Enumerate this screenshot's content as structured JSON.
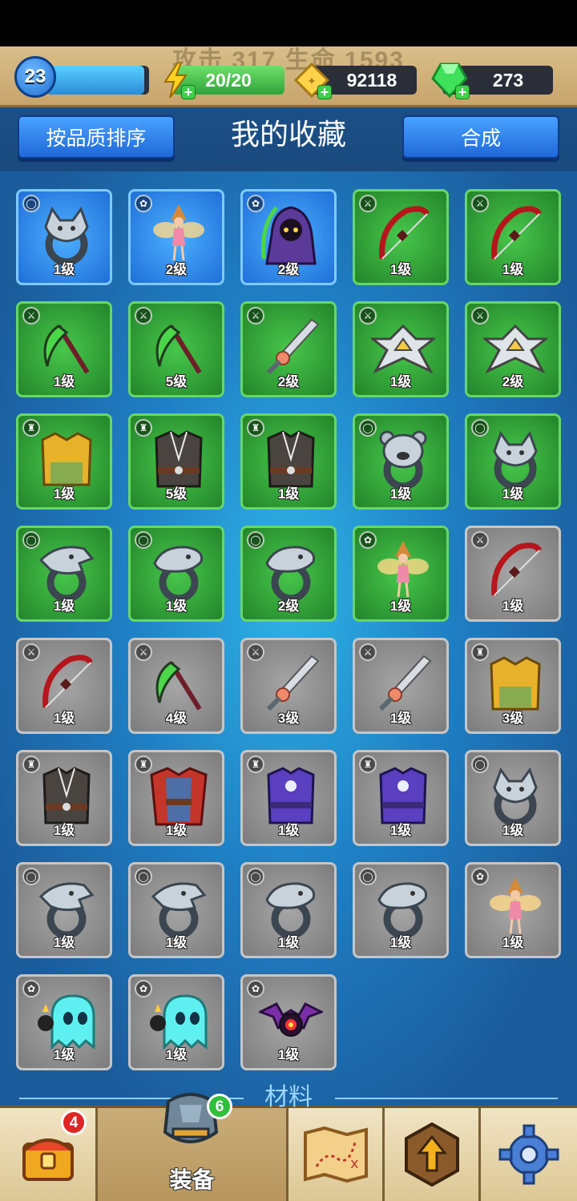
{
  "header_stats": {
    "ghost_text": "攻击 317  生命 1593"
  },
  "player": {
    "level": "23",
    "xp_fraction": 0.95
  },
  "resources": {
    "energy": "20/20",
    "coins": "92118",
    "gems": "273"
  },
  "toolbar": {
    "sort_label": "按品质排序",
    "title": "我的收藏",
    "combine_label": "合成"
  },
  "items": [
    {
      "level": "1级",
      "rarity": "blue",
      "slot": "ring",
      "art": "wolf-ring"
    },
    {
      "level": "2级",
      "rarity": "blue",
      "slot": "pet",
      "art": "fairy"
    },
    {
      "level": "2级",
      "rarity": "blue",
      "slot": "pet",
      "art": "reaper"
    },
    {
      "level": "1级",
      "rarity": "green",
      "slot": "weapon",
      "art": "bow"
    },
    {
      "level": "1级",
      "rarity": "green",
      "slot": "weapon",
      "art": "bow"
    },
    {
      "level": "1级",
      "rarity": "green",
      "slot": "weapon",
      "art": "scythe"
    },
    {
      "level": "5级",
      "rarity": "green",
      "slot": "weapon",
      "art": "scythe"
    },
    {
      "level": "2级",
      "rarity": "green",
      "slot": "weapon",
      "art": "sword"
    },
    {
      "level": "1级",
      "rarity": "green",
      "slot": "weapon",
      "art": "shuriken"
    },
    {
      "level": "2级",
      "rarity": "green",
      "slot": "weapon",
      "art": "shuriken"
    },
    {
      "level": "1级",
      "rarity": "green",
      "slot": "armor",
      "art": "gold-armor"
    },
    {
      "level": "5级",
      "rarity": "green",
      "slot": "armor",
      "art": "dark-vest"
    },
    {
      "level": "1级",
      "rarity": "green",
      "slot": "armor",
      "art": "dark-vest"
    },
    {
      "level": "1级",
      "rarity": "green",
      "slot": "ring",
      "art": "bear-ring"
    },
    {
      "level": "1级",
      "rarity": "green",
      "slot": "ring",
      "art": "wolf-ring"
    },
    {
      "level": "1级",
      "rarity": "green",
      "slot": "ring",
      "art": "eagle-ring"
    },
    {
      "level": "1级",
      "rarity": "green",
      "slot": "ring",
      "art": "serpent-ring"
    },
    {
      "level": "2级",
      "rarity": "green",
      "slot": "ring",
      "art": "serpent-ring"
    },
    {
      "level": "1级",
      "rarity": "green",
      "slot": "pet",
      "art": "fairy"
    },
    {
      "level": "1级",
      "rarity": "gray",
      "slot": "weapon",
      "art": "bow"
    },
    {
      "level": "1级",
      "rarity": "gray",
      "slot": "weapon",
      "art": "bow"
    },
    {
      "level": "4级",
      "rarity": "gray",
      "slot": "weapon",
      "art": "scythe"
    },
    {
      "level": "3级",
      "rarity": "gray",
      "slot": "weapon",
      "art": "sword"
    },
    {
      "level": "1级",
      "rarity": "gray",
      "slot": "weapon",
      "art": "sword"
    },
    {
      "level": "3级",
      "rarity": "gray",
      "slot": "armor",
      "art": "gold-armor"
    },
    {
      "level": "1级",
      "rarity": "gray",
      "slot": "armor",
      "art": "dark-vest"
    },
    {
      "level": "1级",
      "rarity": "gray",
      "slot": "armor",
      "art": "red-robe"
    },
    {
      "level": "1级",
      "rarity": "gray",
      "slot": "armor",
      "art": "purple-robe"
    },
    {
      "level": "1级",
      "rarity": "gray",
      "slot": "armor",
      "art": "purple-robe"
    },
    {
      "level": "1级",
      "rarity": "gray",
      "slot": "ring",
      "art": "wolf-ring"
    },
    {
      "level": "1级",
      "rarity": "gray",
      "slot": "ring",
      "art": "eagle-ring"
    },
    {
      "level": "1级",
      "rarity": "gray",
      "slot": "ring",
      "art": "eagle-ring"
    },
    {
      "level": "1级",
      "rarity": "gray",
      "slot": "ring",
      "art": "serpent-ring"
    },
    {
      "level": "1级",
      "rarity": "gray",
      "slot": "ring",
      "art": "serpent-ring"
    },
    {
      "level": "1级",
      "rarity": "gray",
      "slot": "pet",
      "art": "fairy"
    },
    {
      "level": "1级",
      "rarity": "gray",
      "slot": "pet",
      "art": "ghost"
    },
    {
      "level": "1级",
      "rarity": "gray",
      "slot": "pet",
      "art": "ghost"
    },
    {
      "level": "1级",
      "rarity": "gray",
      "slot": "pet",
      "art": "bat"
    }
  ],
  "materials_label": "材料",
  "nav": {
    "chest_badge": "4",
    "equip_badge": "6",
    "equip_label": "装备"
  },
  "colors": {
    "blue_rarity": "#1f6fd8",
    "green_rarity": "#23852a",
    "gray_rarity": "#7c7c7c",
    "badge_red": "#e02525",
    "badge_green": "#2fbf3a"
  }
}
